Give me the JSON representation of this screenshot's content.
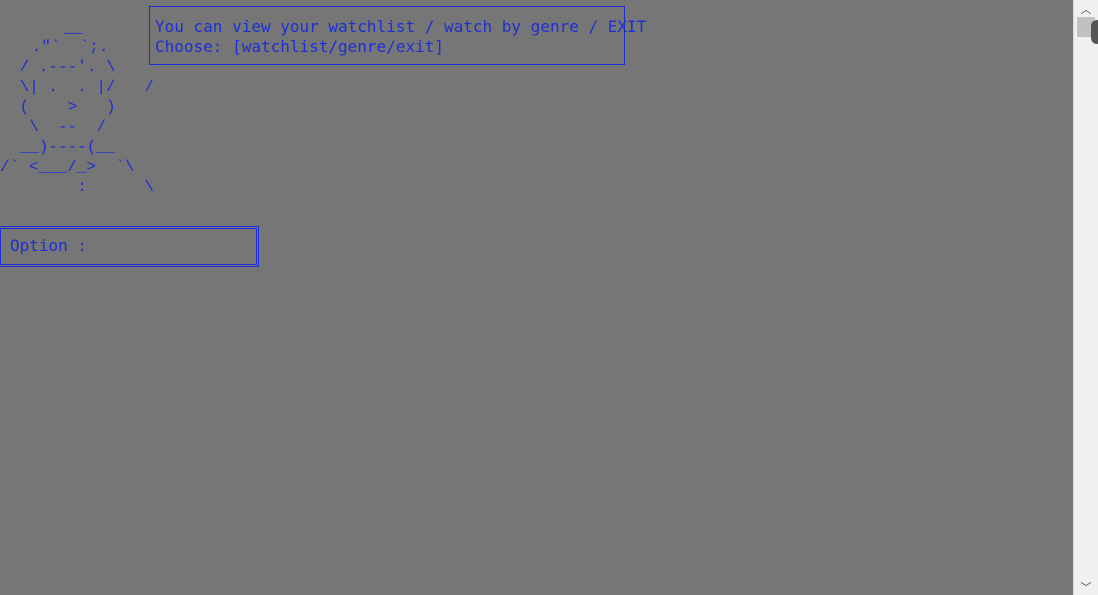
{
  "ascii_art": {
    "lines": [
      "   __",
      " .\"`  `;.",
      " / .---'. \\",
      " \\| .  . |/   /",
      " (    >   )",
      "  \\  --  /",
      " __)----(__",
      "/` <___/_>  `\\",
      "       :      \\"
    ]
  },
  "prompt": {
    "line1": "You can view your watchlist / watch by genre / EXIT",
    "line2": "Choose: [watchlist/genre/exit]"
  },
  "option": {
    "label": "Option :",
    "value": ""
  },
  "scrollbar": {
    "up_icon": "chevron-up-icon",
    "down_icon": "chevron-down-icon",
    "up_glyph": "︿",
    "down_glyph": "﹀"
  },
  "colors": {
    "background": "#767676",
    "text": "#1c2fd6"
  }
}
